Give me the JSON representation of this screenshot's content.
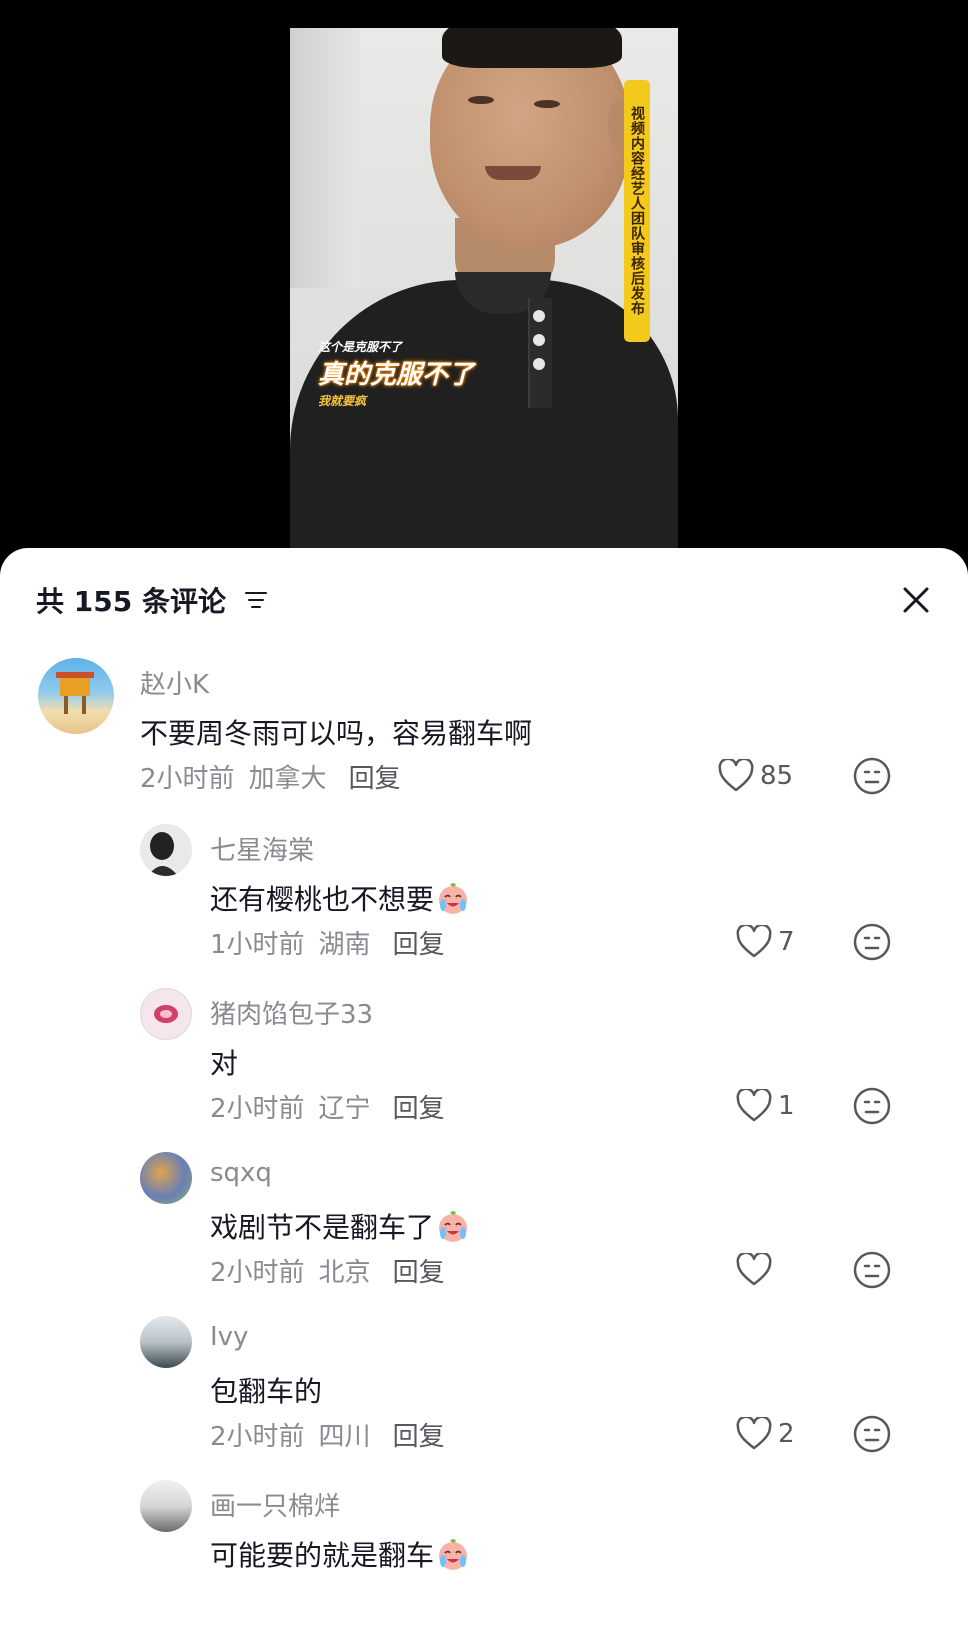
{
  "video": {
    "vertical_caption": "视频内容经艺人团队审核后发布",
    "caption_small": "这个是克服不了",
    "caption_main": "真的克服不了",
    "caption_sub": "我就要疯"
  },
  "sheet": {
    "title": "共 155 条评论",
    "sort_icon": "sort-filter-icon",
    "close_icon": "close-icon"
  },
  "comments": [
    {
      "user": "赵小K",
      "text": "不要周冬雨可以吗，容易翻车啊",
      "time": "2小时前",
      "location": "加拿大",
      "reply": "回复",
      "likes": "85",
      "emoji": false,
      "avatar_colors": [
        "#5fb1e6",
        "#f2b134",
        "#c9502a"
      ]
    },
    {
      "user": "七星海棠",
      "text": "还有樱桃也不想要",
      "time": "1小时前",
      "location": "湖南",
      "reply": "回复",
      "likes": "7",
      "emoji": true,
      "avatar_colors": [
        "#e9e9e9",
        "#222222",
        "#bbbbbb"
      ]
    },
    {
      "user": "猪肉馅包子33",
      "text": "对",
      "time": "2小时前",
      "location": "辽宁",
      "reply": "回复",
      "likes": "1",
      "emoji": false,
      "avatar_colors": [
        "#f3d9e4",
        "#d0406a",
        "#ffffff"
      ]
    },
    {
      "user": "sqxq",
      "text": "戏剧节不是翻车了",
      "time": "2小时前",
      "location": "北京",
      "reply": "回复",
      "likes": "",
      "emoji": true,
      "avatar_colors": [
        "#6a7fb6",
        "#e0a44d",
        "#8bb36b"
      ]
    },
    {
      "user": "Ivy",
      "text": "包翻车的",
      "time": "2小时前",
      "location": "四川",
      "reply": "回复",
      "likes": "2",
      "emoji": false,
      "avatar_colors": [
        "#b9c3c8",
        "#3c4a50",
        "#e4e8ea"
      ]
    },
    {
      "user": "画一只棉烊",
      "text": "可能要的就是翻车",
      "time": "",
      "location": "",
      "reply": "",
      "likes": "",
      "emoji": true,
      "avatar_colors": [
        "#d7d7d7",
        "#6b6b6b",
        "#f1f1f1"
      ]
    }
  ],
  "icons": {
    "like": "heart-outline-icon",
    "dislike": "neutral-face-icon",
    "emoji": "crying-laughing-emoji-icon"
  }
}
